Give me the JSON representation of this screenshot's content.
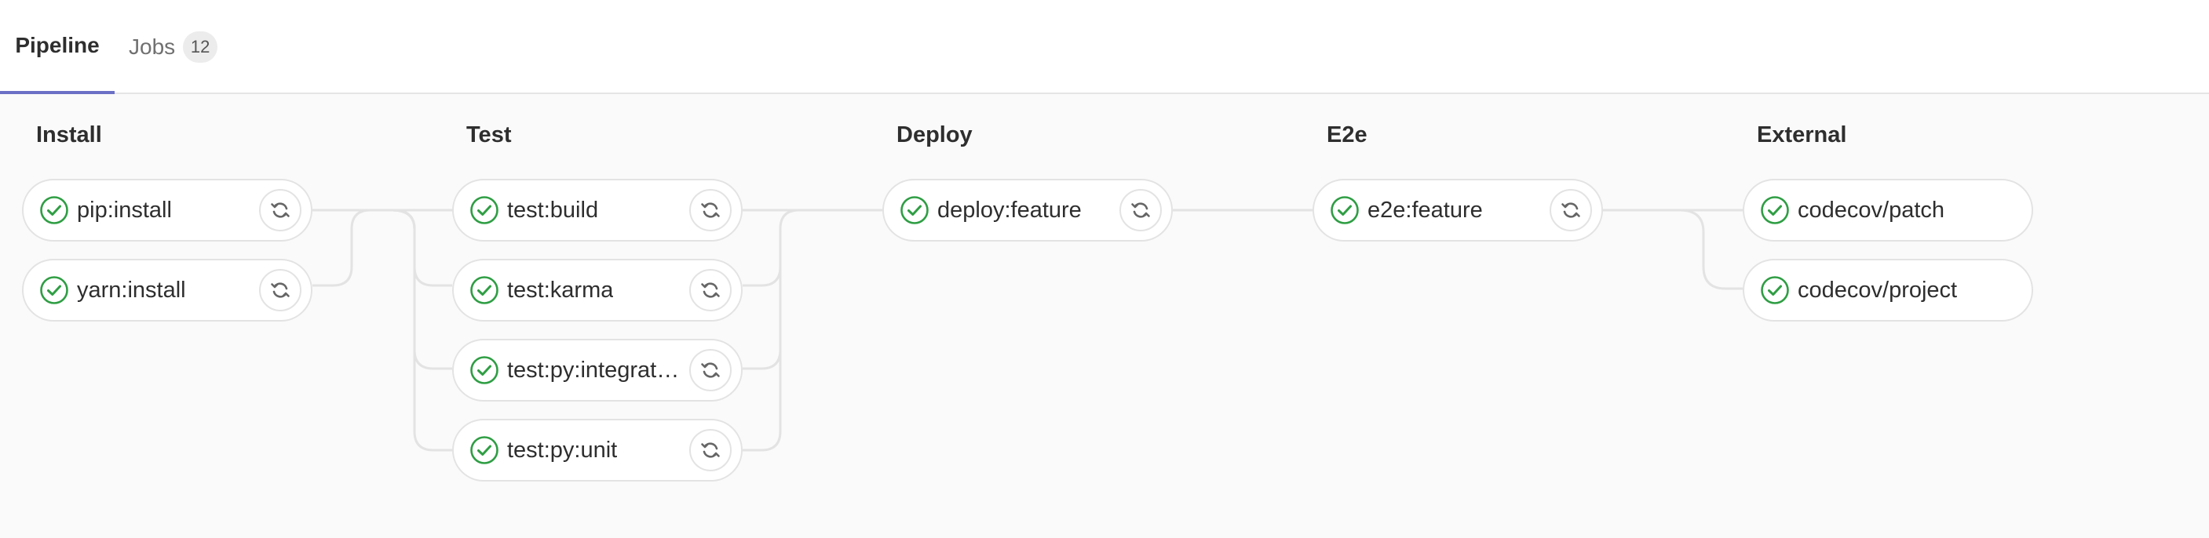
{
  "tabs": [
    {
      "label": "Pipeline",
      "active": true
    },
    {
      "label": "Jobs",
      "count": "12",
      "active": false
    }
  ],
  "colors": {
    "success": "#2f9e44",
    "active_tab_underline": "#6b6fc5",
    "connector": "#e3e3e3"
  },
  "stages": [
    {
      "title": "Install",
      "jobs": [
        {
          "name": "pip:install",
          "status": "success",
          "action": "retry-icon"
        },
        {
          "name": "yarn:install",
          "status": "success",
          "action": "retry-icon"
        }
      ]
    },
    {
      "title": "Test",
      "jobs": [
        {
          "name": "test:build",
          "status": "success",
          "action": "retry-icon"
        },
        {
          "name": "test:karma",
          "status": "success",
          "action": "retry-icon"
        },
        {
          "name": "test:py:integrat…",
          "status": "success",
          "action": "retry-icon"
        },
        {
          "name": "test:py:unit",
          "status": "success",
          "action": "retry-icon"
        }
      ]
    },
    {
      "title": "Deploy",
      "jobs": [
        {
          "name": "deploy:feature",
          "status": "success",
          "action": "retry-icon"
        }
      ]
    },
    {
      "title": "E2e",
      "jobs": [
        {
          "name": "e2e:feature",
          "status": "success",
          "action": "retry-icon"
        }
      ]
    },
    {
      "title": "External",
      "jobs": [
        {
          "name": "codecov/patch",
          "status": "success"
        },
        {
          "name": "codecov/project",
          "status": "success"
        }
      ]
    }
  ]
}
